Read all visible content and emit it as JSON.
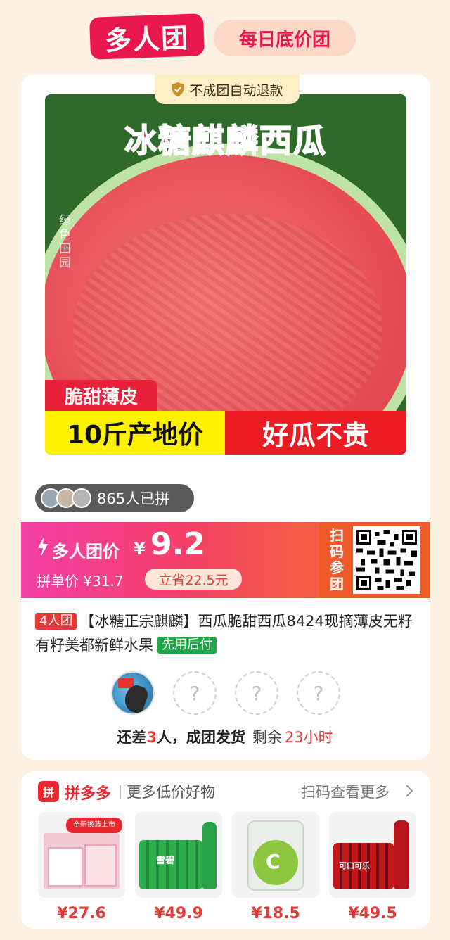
{
  "header": {
    "logo_text": "多人团",
    "daily_tag": "每日底价团"
  },
  "product": {
    "refund_text": "不成团自动退款",
    "image": {
      "title": "冰糖麒麟西瓜",
      "watermark": "绿色田园",
      "tag": "脆甜薄皮",
      "banner_left": "10斤产地价",
      "banner_right": "好瓜不贵"
    },
    "joined_text": "865人已拼",
    "price": {
      "label": "多人团价",
      "currency": "¥",
      "value": "9.2",
      "single_price": "拼单价 ¥31.7",
      "save": "立省22.5元",
      "scan_label": "扫码参团"
    },
    "title": {
      "group_tag": "4人团",
      "text": "【冰糖正宗麒麟】西瓜脆甜西瓜8424现摘薄皮无籽有籽美都新鲜水果",
      "paylater_tag": "先用后付"
    },
    "members": {
      "empty_mark": "?"
    },
    "status": {
      "prefix": "还差",
      "count": "3",
      "suffix": "人，成团发货",
      "remain_label": "剩余",
      "hours": "23小时"
    }
  },
  "more": {
    "logo_char": "拼",
    "brand": "拼多多",
    "label": "更多低价好物",
    "scan_more": "扫码查看更多",
    "items": [
      {
        "price": "¥27.6",
        "icon": "tissue-pack-icon",
        "img_text": "全新换装上市"
      },
      {
        "price": "¥49.9",
        "icon": "sprite-bottles-icon",
        "img_text": "雪碧"
      },
      {
        "price": "¥18.5",
        "icon": "detergent-pouch-icon",
        "img_text": "C"
      },
      {
        "price": "¥49.5",
        "icon": "cola-bottles-icon",
        "img_text": "可口可乐"
      }
    ]
  },
  "colors": {
    "brand_red": "#e8184e",
    "price_gradient_start": "#f43fa6",
    "price_gradient_end": "#f35f3f",
    "paylater_green": "#1ea84a"
  }
}
